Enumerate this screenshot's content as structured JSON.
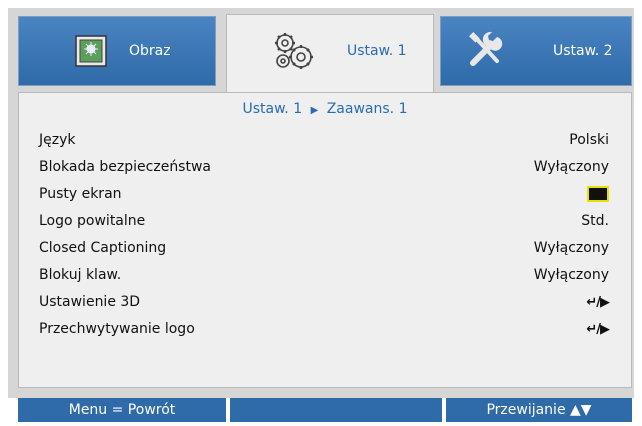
{
  "tabs": [
    {
      "label": "Obraz",
      "icon": "image-adjust-icon",
      "active": false
    },
    {
      "label": "Ustaw. 1",
      "icon": "gears-icon",
      "active": true
    },
    {
      "label": "Ustaw. 2",
      "icon": "tools-icon",
      "active": false
    }
  ],
  "breadcrumb": {
    "parent": "Ustaw. 1",
    "arrow": "▶",
    "current": "Zaawans. 1"
  },
  "rows": [
    {
      "label": "Język",
      "value": "Polski"
    },
    {
      "label": "Blokada bezpieczeństwa",
      "value": "Wyłączony"
    },
    {
      "label": "Pusty ekran",
      "value": "",
      "swatch": "#111111"
    },
    {
      "label": "Logo powitalne",
      "value": "Std."
    },
    {
      "label": "Closed Captioning",
      "value": "Wyłączony"
    },
    {
      "label": "Blokuj klaw.",
      "value": "Wyłączony"
    },
    {
      "label": "Ustawienie 3D",
      "value": "↵/▶"
    },
    {
      "label": "Przechwytywanie logo",
      "value": "↵/▶"
    }
  ],
  "footer": {
    "left": "Menu = Powrót",
    "middle": "",
    "right": "Przewijanie ▲▼"
  },
  "colors": {
    "accent_blue": "#2f6aa9",
    "active_text": "#2a6bb3",
    "swatch_border": "#e8e000"
  }
}
